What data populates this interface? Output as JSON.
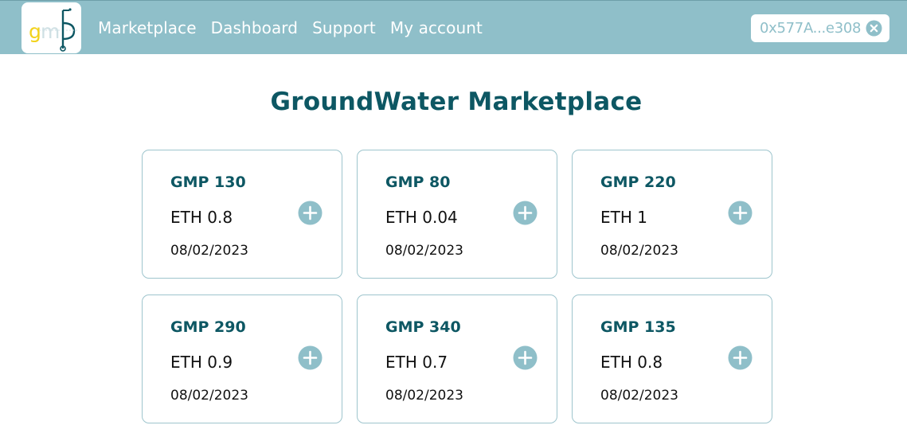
{
  "nav": {
    "logo_text": "gmp",
    "links": [
      "Marketplace",
      "Dashboard",
      "Support",
      "My account"
    ]
  },
  "wallet": {
    "address": "0x577A...e308"
  },
  "page": {
    "title": "GroundWater Marketplace"
  },
  "listings": [
    {
      "title": "GMP 130",
      "price": "ETH 0.8",
      "date": "08/02/2023"
    },
    {
      "title": "GMP 80",
      "price": "ETH 0.04",
      "date": "08/02/2023"
    },
    {
      "title": "GMP 220",
      "price": "ETH 1",
      "date": "08/02/2023"
    },
    {
      "title": "GMP 290",
      "price": "ETH 0.9",
      "date": "08/02/2023"
    },
    {
      "title": "GMP 340",
      "price": "ETH 0.7",
      "date": "08/02/2023"
    },
    {
      "title": "GMP 135",
      "price": "ETH 0.8",
      "date": "08/02/2023"
    }
  ],
  "colors": {
    "navbar": "#8fbfc9",
    "accent": "#0d5763",
    "logo_yellow": "#f2d21b"
  },
  "icons": {
    "add": "plus-circle-icon",
    "clear": "close-circle-icon",
    "logo": "gmp-logo"
  }
}
